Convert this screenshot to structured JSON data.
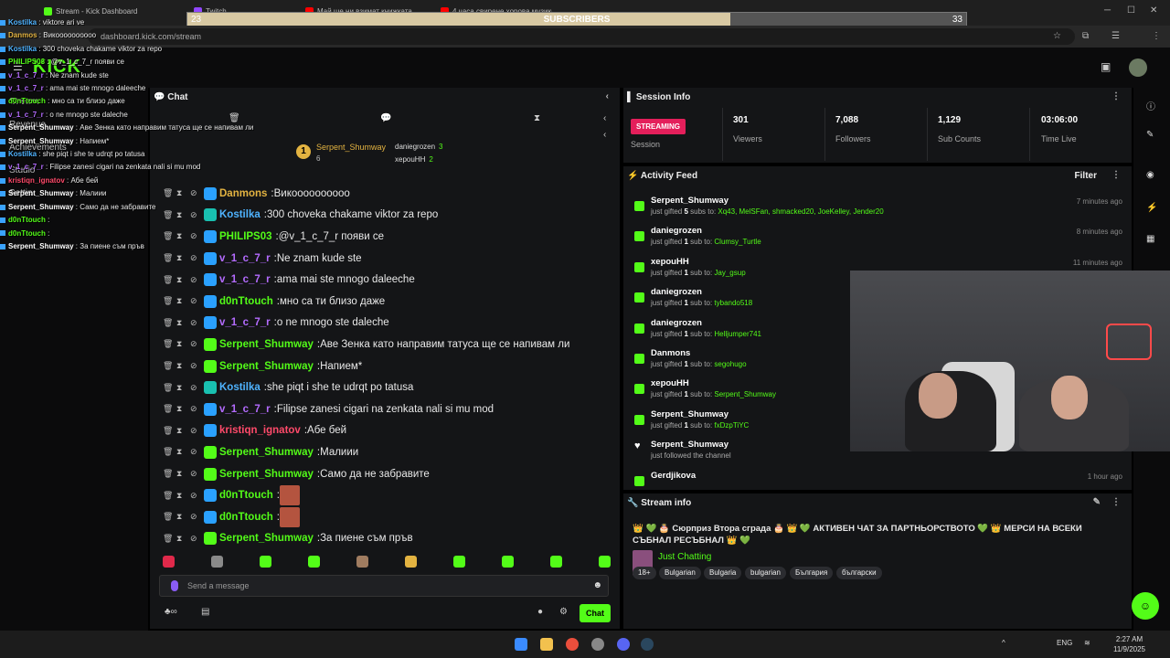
{
  "browser": {
    "tabs": [
      "Stream - Kick Dashboard",
      "Twitch",
      "Май ще ни взимат книжката",
      "4 часа свирене хорова музика"
    ],
    "url": "dashboard.kick.com/stream"
  },
  "subscribers": {
    "label": "SUBSCRIBERS",
    "current": "23",
    "goal": "33",
    "progress": 0.697
  },
  "overlay_chat": [
    {
      "user": "Kostilka",
      "text": "viktore ari ve",
      "color": "#4fb3ff"
    },
    {
      "user": "Danmos",
      "text": "Викоооооооооо",
      "color": "#e3b341"
    },
    {
      "user": "Kostilka",
      "text": "300 choveka chakame viktor za repo",
      "color": "#4fb3ff"
    },
    {
      "user": "PHILIPS03",
      "text": "@v_1_c_7_r появи се",
      "color": "#53fc18"
    },
    {
      "user": "v_1_c_7_r",
      "text": "Ne znam kude ste",
      "color": "#b46bff"
    },
    {
      "user": "v_1_c_7_r",
      "text": "ama mai ste mnogo daleeche",
      "color": "#b46bff"
    },
    {
      "user": "d0nTtouch",
      "text": "мно са ти близо даже",
      "color": "#53fc18"
    },
    {
      "user": "v_1_c_7_r",
      "text": "o ne mnogo ste daleche",
      "color": "#b46bff"
    },
    {
      "user": "Serpent_Shumway",
      "text": "Аве Зенка като направим татуса ще се напивам ли",
      "color": "#ffffff"
    },
    {
      "user": "Serpent_Shumway",
      "text": "Напием*",
      "color": "#ffffff"
    },
    {
      "user": "Kostilka",
      "text": "she piqt i she te udrqt po tatusa",
      "color": "#4fb3ff"
    },
    {
      "user": "v_1_c_7_r",
      "text": "Filipse zanesi cigari na zenkata nali si mu mod",
      "color": "#b46bff"
    },
    {
      "user": "kristiqn_ignatov",
      "text": "Абе бей",
      "color": "#ff4a6a"
    },
    {
      "user": "Serpent_Shumway",
      "text": "Малиии",
      "color": "#ffffff"
    },
    {
      "user": "Serpent_Shumway",
      "text": "Само да не забравите",
      "color": "#ffffff"
    },
    {
      "user": "d0nTtouch",
      "text": "",
      "color": "#53fc18"
    },
    {
      "user": "d0nTtouch",
      "text": "",
      "color": "#53fc18"
    },
    {
      "user": "Serpent_Shumway",
      "text": "За пиене съм пръв",
      "color": "#ffffff"
    }
  ],
  "sidenav": [
    "Stream",
    "Revenue",
    "Achievements",
    "Studio",
    "Settin"
  ],
  "chat": {
    "title": "Chat",
    "pinned": {
      "rank": "1",
      "name": "Serpent_Shumway",
      "count": "6",
      "others": [
        {
          "name": "daniegrozen",
          "count": "3"
        },
        {
          "name": "xepouHH",
          "count": "2"
        }
      ]
    },
    "messages": [
      {
        "user": "Danmons",
        "text": "Викоооооооооо",
        "color": "#e3b341",
        "badge": "#2aa1ff"
      },
      {
        "user": "Kostilka",
        "text": "300 choveka chakame viktor za repo",
        "color": "#4fb3ff",
        "badge": "#19c0b0"
      },
      {
        "user": "PHILIPS03",
        "text": "@v_1_c_7_r появи се",
        "color": "#53fc18",
        "badge": "#2aa1ff"
      },
      {
        "user": "v_1_c_7_r",
        "text": "Ne znam kude ste",
        "color": "#b46bff",
        "badge": "#2aa1ff"
      },
      {
        "user": "v_1_c_7_r",
        "text": "ama mai ste mnogo daleeche",
        "color": "#b46bff",
        "badge": "#2aa1ff"
      },
      {
        "user": "d0nTtouch",
        "text": "мно са ти близо даже",
        "color": "#53fc18",
        "badge": "#2aa1ff"
      },
      {
        "user": "v_1_c_7_r",
        "text": "o ne mnogo ste daleche",
        "color": "#b46bff",
        "badge": "#2aa1ff"
      },
      {
        "user": "Serpent_Shumway",
        "text": "Аве Зенка като направим татуса ще се напивам ли",
        "color": "#53fc18",
        "badge": "#53fc18"
      },
      {
        "user": "Serpent_Shumway",
        "text": "Напием*",
        "color": "#53fc18",
        "badge": "#53fc18"
      },
      {
        "user": "Kostilka",
        "text": "she piqt i she te udrqt po tatusa",
        "color": "#4fb3ff",
        "badge": "#19c0b0"
      },
      {
        "user": "v_1_c_7_r",
        "text": "Filipse zanesi cigari na zenkata nali si mu mod",
        "color": "#b46bff",
        "badge": "#2aa1ff"
      },
      {
        "user": "kristiqn_ignatov",
        "text": "Абе бей",
        "color": "#ff4a6a",
        "badge": "#2aa1ff"
      },
      {
        "user": "Serpent_Shumway",
        "text": "Малиии",
        "color": "#53fc18",
        "badge": "#53fc18"
      },
      {
        "user": "Serpent_Shumway",
        "text": "Само да не забравите",
        "color": "#53fc18",
        "badge": "#53fc18"
      },
      {
        "user": "d0nTtouch",
        "text": "",
        "color": "#53fc18",
        "badge": "#2aa1ff"
      },
      {
        "user": "d0nTtouch",
        "text": "",
        "color": "#53fc18",
        "badge": "#2aa1ff"
      },
      {
        "user": "Serpent_Shumway",
        "text": "За пиене съм пръв",
        "color": "#53fc18",
        "badge": "#53fc18"
      }
    ],
    "input_placeholder": "Send a message",
    "send_label": "Chat"
  },
  "session": {
    "title": "Session Info",
    "status": "STREAMING",
    "status_label": "Session",
    "stats": [
      {
        "value": "301",
        "label": "Viewers"
      },
      {
        "value": "7,088",
        "label": "Followers"
      },
      {
        "value": "1,129",
        "label": "Sub Counts"
      },
      {
        "value": "03:06:00",
        "label": "Time Live"
      }
    ]
  },
  "activity": {
    "title": "Activity Feed",
    "filter_label": "Filter",
    "items": [
      {
        "name": "Serpent_Shumway",
        "pre": "just gifted ",
        "num": "5",
        "mid": " subs to: ",
        "to": "Xq43, MelSFan, shmacked20, JoeKelley, Jender20",
        "time": "7 minutes ago",
        "kind": "gift"
      },
      {
        "name": "daniegrozen",
        "pre": "just gifted ",
        "num": "1",
        "mid": " sub to: ",
        "to": "Clumsy_Turtle",
        "time": "8 minutes ago",
        "kind": "gift"
      },
      {
        "name": "xepouHH",
        "pre": "just gifted ",
        "num": "1",
        "mid": " sub to: ",
        "to": "Jay_gsup",
        "time": "11 minutes ago",
        "kind": "gift"
      },
      {
        "name": "daniegrozen",
        "pre": "just gifted ",
        "num": "1",
        "mid": " sub to: ",
        "to": "tybando518",
        "time": "",
        "kind": "gift"
      },
      {
        "name": "daniegrozen",
        "pre": "just gifted ",
        "num": "1",
        "mid": " sub to: ",
        "to": "Helljumper741",
        "time": "",
        "kind": "gift"
      },
      {
        "name": "Danmons",
        "pre": "just gifted ",
        "num": "1",
        "mid": " sub to: ",
        "to": "segohugo",
        "time": "",
        "kind": "gift"
      },
      {
        "name": "xepouHH",
        "pre": "just gifted ",
        "num": "1",
        "mid": " sub to: ",
        "to": "Serpent_Shumway",
        "time": "",
        "kind": "gift"
      },
      {
        "name": "Serpent_Shumway",
        "pre": "just gifted ",
        "num": "1",
        "mid": " sub to: ",
        "to": "fxDzpTiYC",
        "time": "",
        "kind": "gift"
      },
      {
        "name": "Serpent_Shumway",
        "pre": "just followed the channel",
        "num": "",
        "mid": "",
        "to": "",
        "time": "",
        "kind": "follow"
      },
      {
        "name": "Gerdjikova",
        "pre": "",
        "num": "",
        "mid": "",
        "to": "",
        "time": "1 hour ago",
        "kind": "gift"
      }
    ]
  },
  "stream_info": {
    "title": "Stream info",
    "stream_title": "👑 💚 🎂 Сюрприз Втора сграда 🎂 👑 💚 АКТИВЕН ЧАТ ЗА ПАРТНЬОРСТВОТО 💚 👑 МЕРСИ НА ВСЕКИ СЪБНАЛ РЕСЪБНАЛ 👑 💚",
    "category": "Just Chatting",
    "tags": [
      "18+",
      "Bulgarian",
      "Bulgaria",
      "bulgarian",
      "България",
      "български"
    ]
  },
  "taskbar": {
    "lang": "ENG",
    "time": "2:27 AM",
    "date": "11/9/2025"
  },
  "colors": {
    "accent": "#53fc18",
    "live": "#e41f5b",
    "panel": "#141517"
  }
}
